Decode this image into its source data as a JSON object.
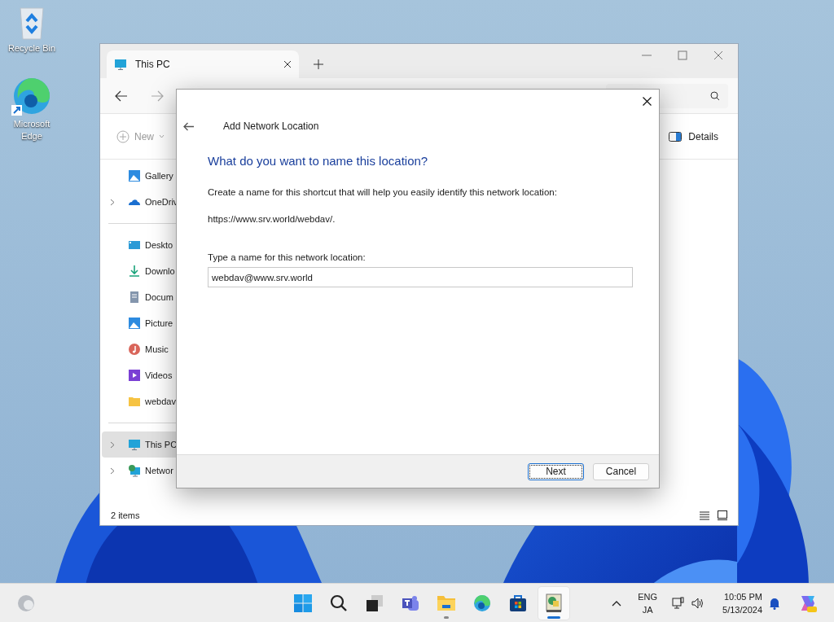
{
  "desktop_icons": [
    {
      "kind": "recycle",
      "label": "Recycle Bin"
    },
    {
      "kind": "edge",
      "label": "Microsoft Edge"
    }
  ],
  "explorer": {
    "tab_title": "This PC",
    "new_label": "New",
    "details_label": "Details",
    "sidebar_groups": [
      [
        {
          "kind": "gallery",
          "label": "Gallery",
          "expandable": false,
          "selected": false
        },
        {
          "kind": "onedrive",
          "label": "OneDriv",
          "expandable": true,
          "selected": false
        }
      ],
      [
        {
          "kind": "desktop",
          "label": "Deskto",
          "expandable": false,
          "selected": false
        },
        {
          "kind": "downloads",
          "label": "Downlo",
          "expandable": false,
          "selected": false
        },
        {
          "kind": "documents",
          "label": "Docum",
          "expandable": false,
          "selected": false
        },
        {
          "kind": "pictures",
          "label": "Picture",
          "expandable": false,
          "selected": false
        },
        {
          "kind": "music",
          "label": "Music",
          "expandable": false,
          "selected": false
        },
        {
          "kind": "videos",
          "label": "Videos",
          "expandable": false,
          "selected": false
        },
        {
          "kind": "folder",
          "label": "webdav",
          "expandable": false,
          "selected": false
        }
      ],
      [
        {
          "kind": "pc",
          "label": "This PC",
          "expandable": true,
          "selected": true
        },
        {
          "kind": "network",
          "label": "Networ",
          "expandable": true,
          "selected": false
        }
      ]
    ],
    "status": "2 items"
  },
  "dialog": {
    "title": "Add Network Location",
    "heading": "What do you want to name this location?",
    "description": "Create a name for this shortcut that will help you easily identify this network location:",
    "address": "https://www.srv.world/webdav/.",
    "field_label": "Type a name for this network location:",
    "field_value": "webdav@www.srv.world",
    "buttons": [
      {
        "label": "Next",
        "focused": true
      },
      {
        "label": "Cancel",
        "focused": false
      }
    ]
  },
  "taskbar": {
    "apps": [
      {
        "kind": "start",
        "running": false,
        "selected": false
      },
      {
        "kind": "search",
        "running": false,
        "selected": false
      },
      {
        "kind": "taskview",
        "running": false,
        "selected": false
      },
      {
        "kind": "teams",
        "running": false,
        "selected": false
      },
      {
        "kind": "explorer",
        "running": true,
        "selected": false
      },
      {
        "kind": "edge",
        "running": false,
        "selected": false
      },
      {
        "kind": "store",
        "running": false,
        "selected": false
      },
      {
        "kind": "netapp",
        "running": true,
        "selected": true
      }
    ],
    "language": [
      "ENG",
      "JA"
    ],
    "time": "10:05 PM",
    "date": "5/13/2024"
  }
}
